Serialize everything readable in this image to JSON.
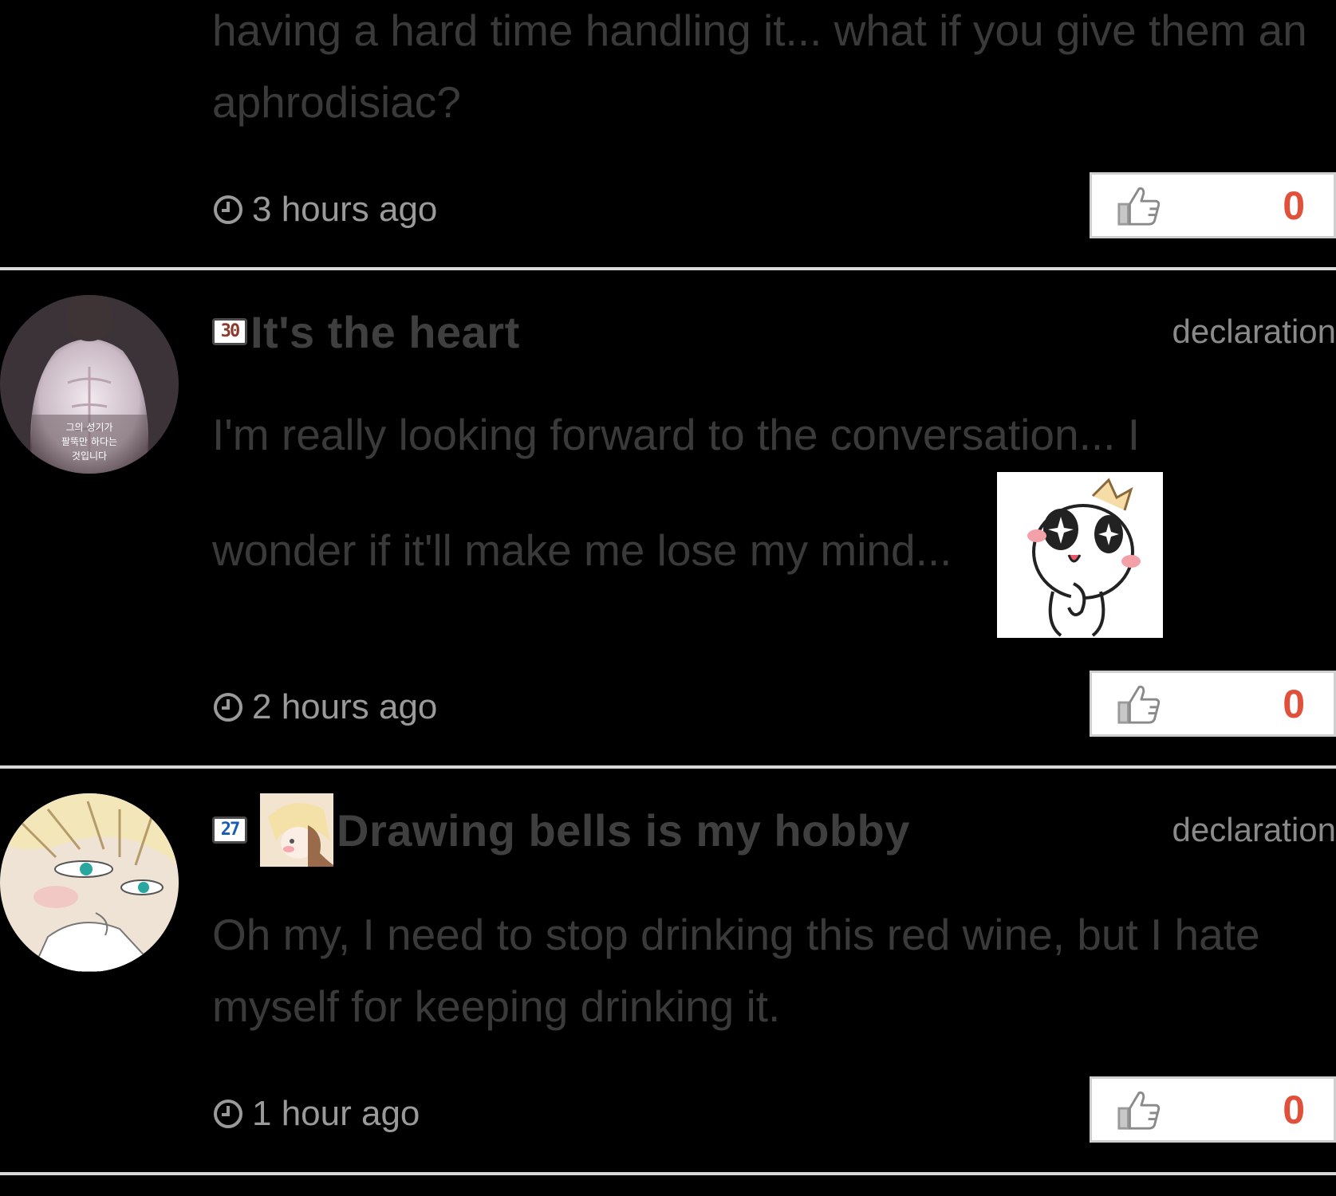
{
  "comments": [
    {
      "body": "having a hard time handling it... what if you give them an aphrodisiac?",
      "time": "3 hours ago",
      "likes": "0"
    },
    {
      "level": "30",
      "username": "It's the heart",
      "declaration": "declaration",
      "body_line1": "I'm really looking forward to the conversation... I",
      "body_line2": "wonder if it'll make me lose my mind...",
      "avatar_caption": [
        "그의 성기가",
        "팔뚝만 하다는",
        "것입니다"
      ],
      "time": "2 hours ago",
      "likes": "0"
    },
    {
      "level": "27",
      "username": "Drawing bells is my hobby",
      "declaration": "declaration",
      "body": "Oh my, I need to stop drinking this red wine, but I hate myself for keeping drinking it.",
      "time": "1 hour ago",
      "likes": "0"
    }
  ],
  "icons": {
    "clock": "clock-icon",
    "like": "thumbs-up-icon"
  },
  "colors": {
    "background": "#000000",
    "like_count": "#e0503a",
    "divider": "#d8d8d8"
  }
}
